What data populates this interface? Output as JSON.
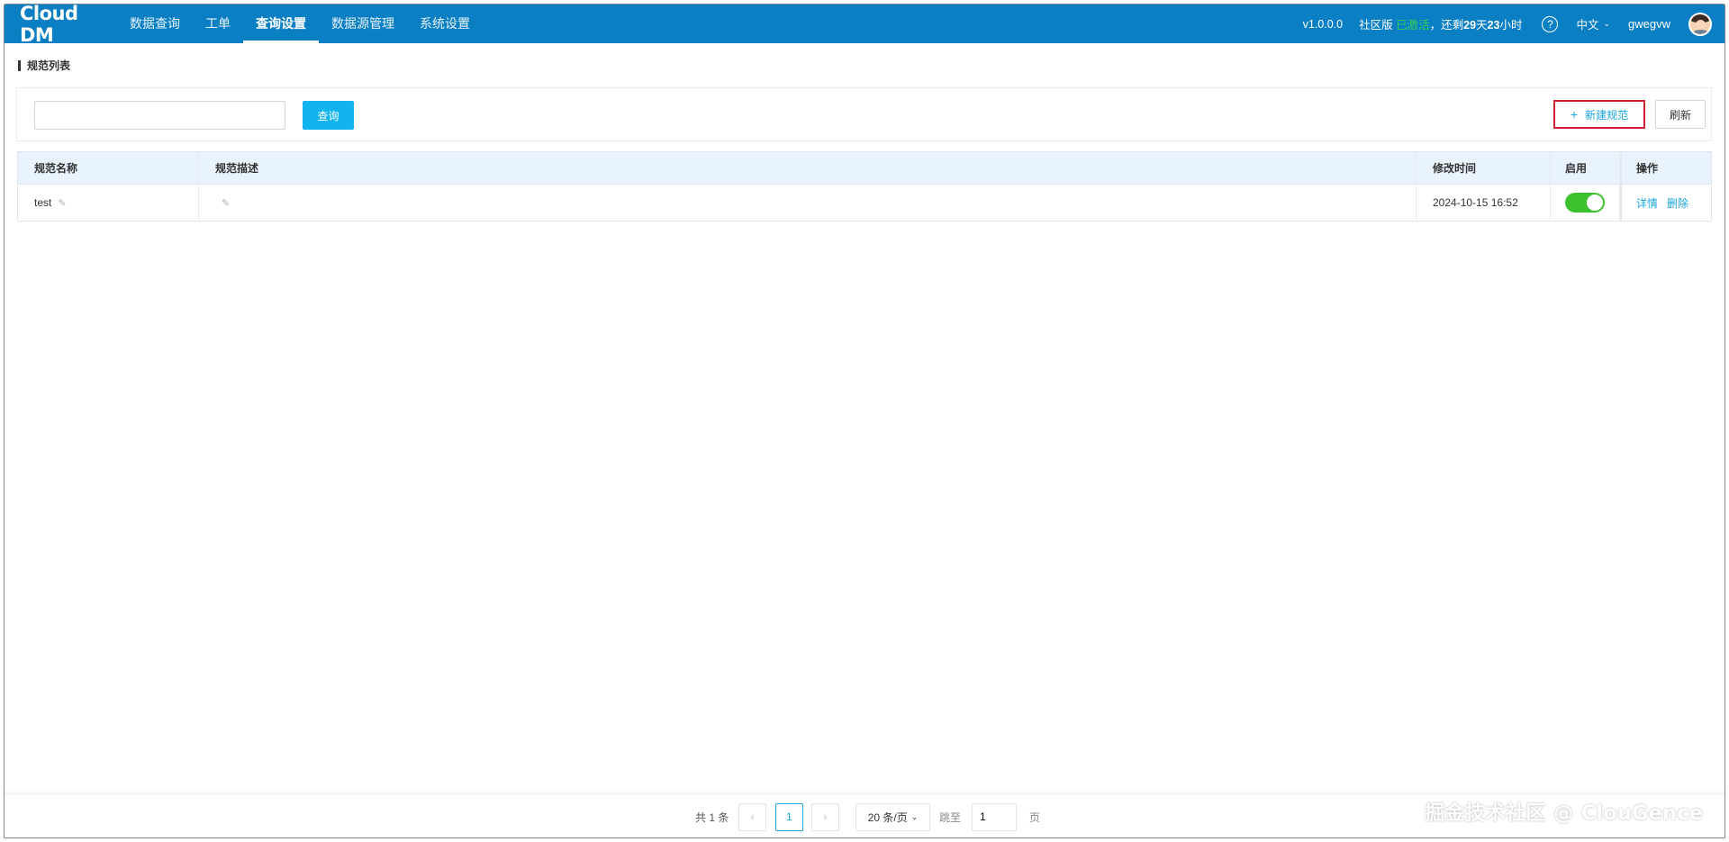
{
  "app": {
    "logo": "Cloud DM"
  },
  "nav": {
    "items": [
      {
        "label": "数据查询"
      },
      {
        "label": "工单"
      },
      {
        "label": "查询设置"
      },
      {
        "label": "数据源管理"
      },
      {
        "label": "系统设置"
      }
    ],
    "active_index": 2
  },
  "header_right": {
    "version": "v1.0.0.0",
    "edition_prefix": "社区版 ",
    "edition_status": "已激活",
    "edition_sep": "，还剩",
    "days": "29",
    "days_unit": "天",
    "hours": "23",
    "hours_unit": "小时",
    "help": "?",
    "language": "中文",
    "username": "gwegvw"
  },
  "page": {
    "title": "规范列表"
  },
  "filter": {
    "search_value": "",
    "search_placeholder": "",
    "query_label": "查询",
    "new_label": "新建规范",
    "refresh_label": "刷新"
  },
  "table": {
    "columns": [
      "规范名称",
      "规范描述",
      "修改时间",
      "启用",
      "操作"
    ],
    "rows": [
      {
        "name": "test",
        "description": "",
        "modified": "2024-10-15 16:52",
        "enabled": true,
        "actions": [
          "详情",
          "删除"
        ]
      }
    ]
  },
  "pagination": {
    "total_text": "共 1 条",
    "current_page": "1",
    "page_size": "20 条/页",
    "jump_label": "跳至",
    "jump_value": "1",
    "jump_suffix": "页"
  },
  "watermark": "掘金技术社区 @ ClouGence",
  "colors": {
    "header_bg": "#0b7fc3",
    "accent": "#12b4ef",
    "link": "#1ba6e0",
    "toggle_on": "#3ec12f",
    "highlight_border": "#d01f2d",
    "activated_text": "#2fd15a"
  }
}
